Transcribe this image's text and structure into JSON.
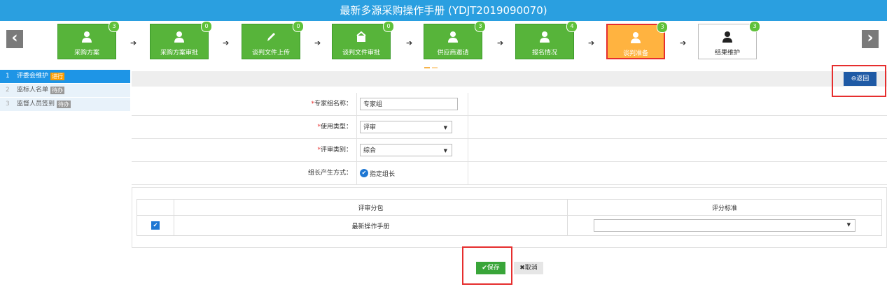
{
  "title": "最新多源采购操作手册 (YDJT2019090070)",
  "steps": [
    {
      "label": "采购方案",
      "badge": "3",
      "icon": "user-icon"
    },
    {
      "label": "采购方案审批",
      "badge": "0",
      "icon": "user-icon"
    },
    {
      "label": "谈判文件上传",
      "badge": "0",
      "icon": "pencil-icon"
    },
    {
      "label": "谈判文件审批",
      "badge": "0",
      "icon": "stamp-icon"
    },
    {
      "label": "供应商邀请",
      "badge": "3",
      "icon": "user-icon"
    },
    {
      "label": "报名情况",
      "badge": "4",
      "icon": "user-icon"
    },
    {
      "label": "谈判准备",
      "badge": "3",
      "icon": "user-icon"
    },
    {
      "label": "结果维护",
      "badge": "3",
      "icon": "user-icon"
    }
  ],
  "nav": {
    "prev": "‹",
    "next": "›"
  },
  "sidebar": [
    {
      "num": "1",
      "label": "评委会维护",
      "tag": "进行"
    },
    {
      "num": "2",
      "label": "监标人名单",
      "tag": "待办"
    },
    {
      "num": "3",
      "label": "监督人员签到",
      "tag": "待办"
    }
  ],
  "back_label": "⊖返回",
  "form": {
    "group_name_label": "专家组名称：",
    "group_name_value": "专家组",
    "use_type_label": "使用类型：",
    "use_type_value": "评审",
    "review_cat_label": "评审类别：",
    "review_cat_value": "综合",
    "leader_label": "组长产生方式：",
    "leader_value": "指定组长",
    "required_mark": "*"
  },
  "grid": {
    "col_package": "评审分包",
    "col_standard": "评分标准",
    "row_package": "最新操作手册"
  },
  "save_label": "✔保存",
  "cancel_label": "✖取消"
}
